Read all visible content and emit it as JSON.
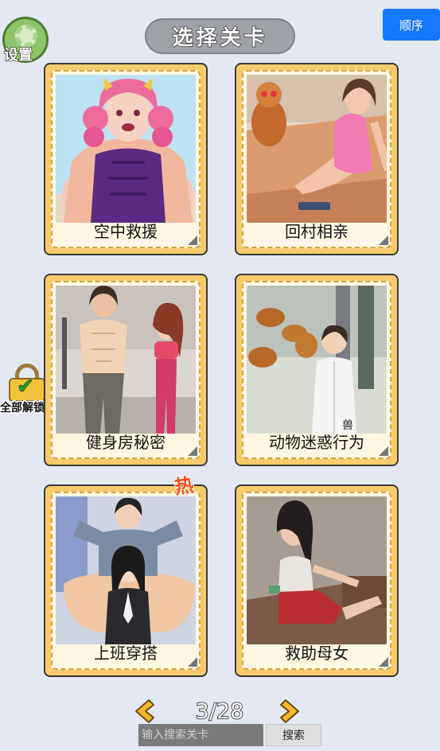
{
  "header": {
    "title": "选择关卡",
    "sort_label": "顺序",
    "settings_label": "设置"
  },
  "unlock_all": {
    "label": "全部解锁"
  },
  "levels": [
    {
      "label": "空中救援",
      "hot": false,
      "art": "muscular-pink-hair-girl"
    },
    {
      "label": "回村相亲",
      "hot": false,
      "art": "woman-on-bed-with-dog"
    },
    {
      "label": "健身房秘密",
      "hot": false,
      "art": "gym-couple"
    },
    {
      "label": "动物迷惑行为",
      "hot": false,
      "art": "vet-with-dogs"
    },
    {
      "label": "上班穿搭",
      "hot": true,
      "art": "office-couple"
    },
    {
      "label": "救助母女",
      "hot": false,
      "art": "injured-woman"
    }
  ],
  "hot_badge": "热",
  "pager": {
    "current": 3,
    "total": 28,
    "text": "3/28"
  },
  "search": {
    "placeholder": "输入搜索关卡",
    "value": "",
    "button_label": "搜索"
  },
  "colors": {
    "background": "#e3e8f3",
    "card_frame": "#f7cb6c",
    "card_inner": "#fff7e4",
    "accent_blue": "#1677ff",
    "arrow": "#f5b82e",
    "hot": "#ff4c1a"
  }
}
